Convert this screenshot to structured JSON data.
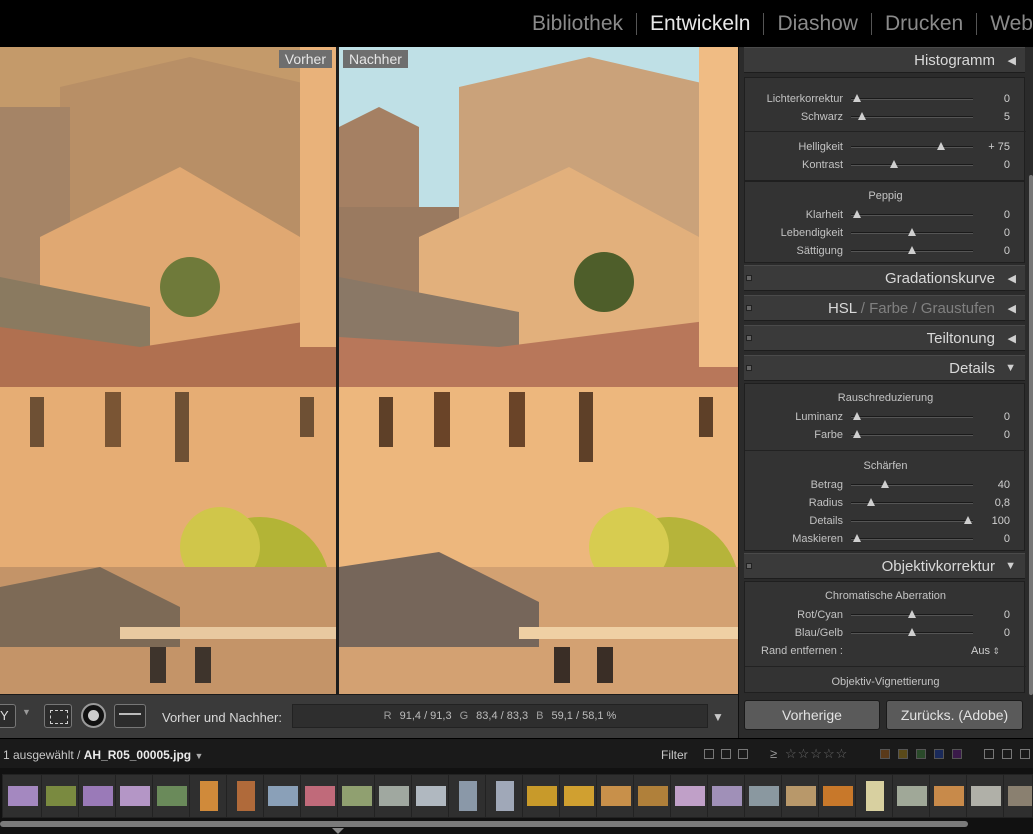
{
  "modules": [
    "Bibliothek",
    "Entwickeln",
    "Diashow",
    "Drucken",
    "Web"
  ],
  "active_module": "Entwickeln",
  "view": {
    "before_label": "Vorher",
    "after_label": "Nachher"
  },
  "toolbar": {
    "view_mode": "Y",
    "before_after_label": "Vorher und Nachher:",
    "rgb": {
      "r_label": "R",
      "r_value": "91,4 /  91,3",
      "g_label": "G",
      "g_value": "83,4 /  83,3",
      "b_label": "B",
      "b_value": "59,1 /  58,1 %"
    }
  },
  "panel": {
    "histogramm": "Histogramm",
    "grundeinstellungen_rows": [
      {
        "label": "Lichterkorrektur",
        "value": "0",
        "pos": 0.05
      },
      {
        "label": "Schwarz",
        "value": "5",
        "pos": 0.09
      },
      {
        "label": "Helligkeit",
        "value": "+ 75",
        "pos": 0.74
      },
      {
        "label": "Kontrast",
        "value": "0",
        "pos": 0.35
      }
    ],
    "peppig": {
      "title": "Peppig",
      "rows": [
        {
          "label": "Klarheit",
          "value": "0",
          "pos": 0.05
        },
        {
          "label": "Lebendigkeit",
          "value": "0",
          "pos": 0.5
        },
        {
          "label": "Sättigung",
          "value": "0",
          "pos": 0.5
        }
      ]
    },
    "gradationskurve": "Gradationskurve",
    "hsl": {
      "a": "HSL",
      "b": "Farbe",
      "c": "Graustufen",
      "sep": "/"
    },
    "teiltonung": "Teiltonung",
    "details": {
      "title": "Details",
      "rausch_title": "Rauschreduzierung",
      "rausch_rows": [
        {
          "label": "Luminanz",
          "value": "0",
          "pos": 0.05
        },
        {
          "label": "Farbe",
          "value": "0",
          "pos": 0.05
        }
      ],
      "schaerfen_title": "Schärfen",
      "schaerfen_rows": [
        {
          "label": "Betrag",
          "value": "40",
          "pos": 0.28
        },
        {
          "label": "Radius",
          "value": "0,8",
          "pos": 0.16
        },
        {
          "label": "Details",
          "value": "100",
          "pos": 0.96
        },
        {
          "label": "Maskieren",
          "value": "0",
          "pos": 0.05
        }
      ]
    },
    "objektiv": {
      "title": "Objektivkorrektur",
      "chroma_title": "Chromatische Aberration",
      "chroma_rows": [
        {
          "label": "Rot/Cyan",
          "value": "0",
          "pos": 0.5
        },
        {
          "label": "Blau/Gelb",
          "value": "0",
          "pos": 0.5
        }
      ],
      "rand_label": "Rand entfernen :",
      "rand_value": "Aus",
      "vignet_title": "Objektiv-Vignettierung"
    },
    "buttons": {
      "prev": "Vorherige",
      "reset": "Zurücks. (Adobe)"
    }
  },
  "filmstrip": {
    "selected_count": "1 ausgewählt /",
    "filename": "AH_R05_00005.jpg",
    "filter_label": "Filter",
    "ge": "≥",
    "stars": "☆☆☆☆☆"
  },
  "colors": {
    "accent": "#e8e8e8",
    "panel": "#2b2b2b",
    "header": "#3a3a3a"
  }
}
